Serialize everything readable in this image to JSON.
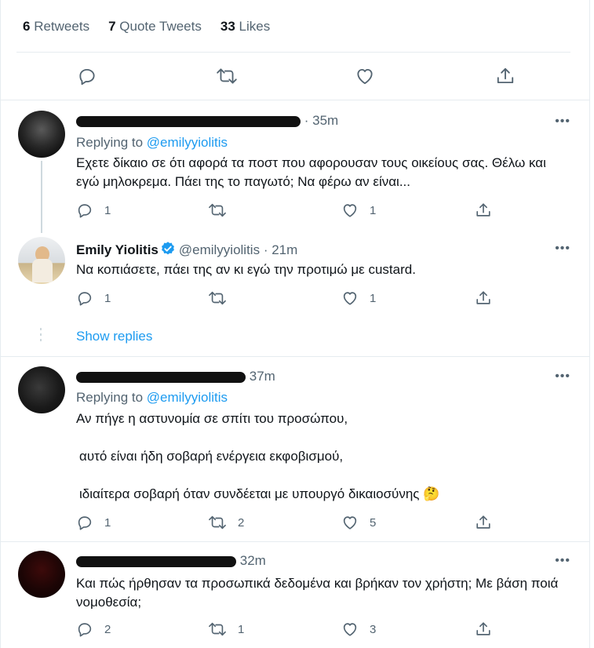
{
  "stats": {
    "retweets_count": "6",
    "retweets_label": "Retweets",
    "quotes_count": "7",
    "quotes_label": "Quote Tweets",
    "likes_count": "33",
    "likes_label": "Likes"
  },
  "icons": {
    "reply": "reply-icon",
    "retweet": "retweet-icon",
    "like": "heart-icon",
    "share": "share-icon",
    "more": "more-icon",
    "verified": "verified-badge-icon"
  },
  "colors": {
    "link": "#1d9bf0",
    "muted": "#536471",
    "border": "#e6ecf0",
    "verified": "#1d9bf0"
  },
  "tweets": [
    {
      "time": "· 35m",
      "replying_prefix": "Replying to",
      "replying_to": "@emilyyiolitis",
      "text": "Εχετε δίκαιο σε ότι αφορά τα ποστ που αφορουσαν τους οικείους σας. Θέλω και εγώ μηλοκρεμα. Πάει της το παγωτό; Να φέρω αν είναι...",
      "replies": "1",
      "retweets": "",
      "likes": "1"
    },
    {
      "name": "Emily Yiolitis",
      "handle": "@emilyyiolitis",
      "time": "· 21m",
      "text": "Να κοπιάσετε, πάει της αν κι εγώ την προτιμώ με custard.",
      "replies": "1",
      "retweets": "",
      "likes": "1"
    },
    {
      "show_replies": "Show replies"
    },
    {
      "time": "37m",
      "replying_prefix": "Replying to",
      "replying_to": "@emilyyiolitis",
      "lines": [
        "Αν πήγε η αστυνομία σε σπίτι του προσώπου,",
        "αυτό είναι ήδη σοβαρή ενέργεια εκφοβισμού,",
        "ιδιαίτερα σοβαρή όταν συνδέεται με υπουργό δικαιοσύνης 🤔"
      ],
      "replies": "1",
      "retweets": "2",
      "likes": "5"
    },
    {
      "time": "32m",
      "text": "Και πώς ήρθησαν τα προσωπικά δεδομένα και βρήκαν τον χρήστη; Με βάση ποιά νομοθεσία;",
      "replies": "2",
      "retweets": "1",
      "likes": "3"
    }
  ]
}
